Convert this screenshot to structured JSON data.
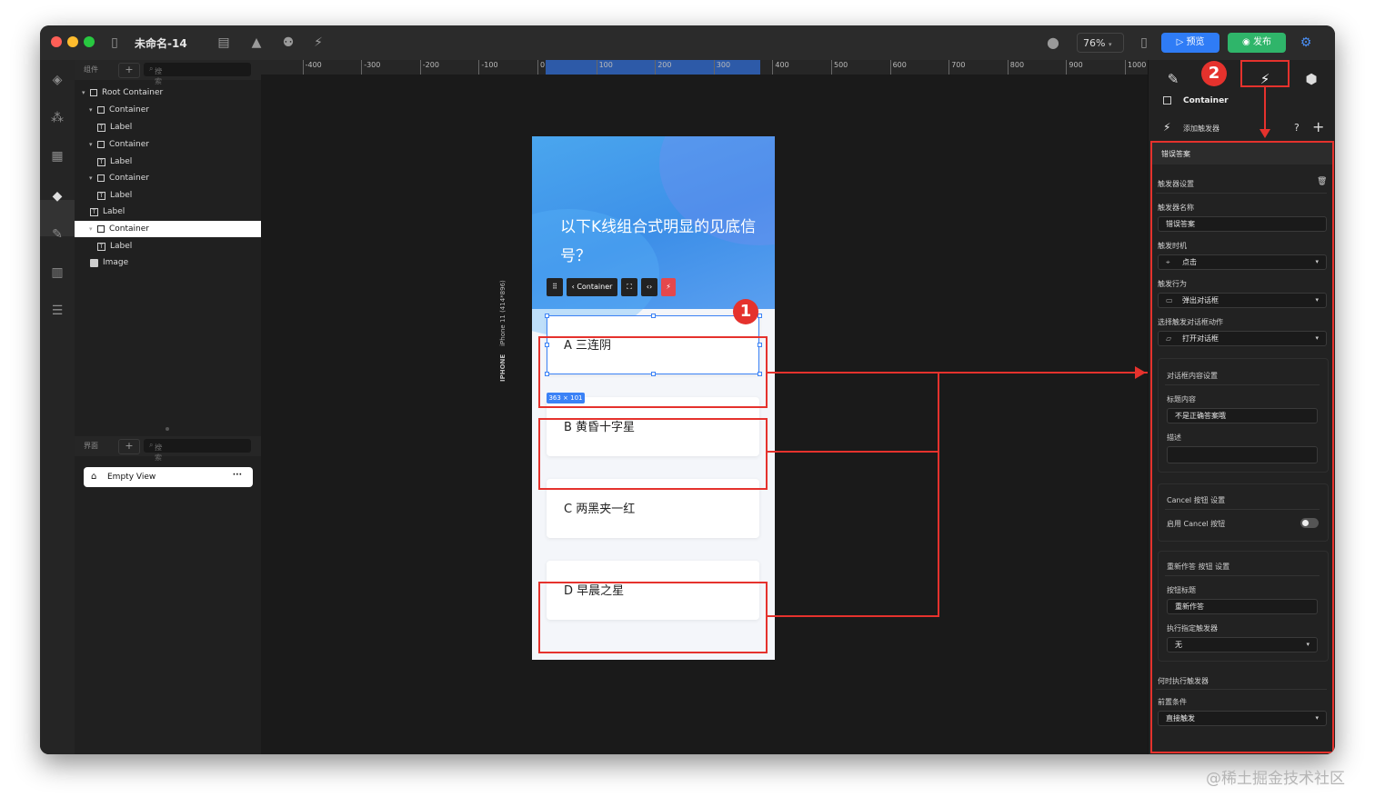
{
  "app": {
    "title": "未命名-14",
    "zoom": "76%",
    "preview_label": "预览",
    "publish_label": "发布"
  },
  "layers_panel": {
    "components_header": "组件",
    "search_placeholder": "搜索",
    "tree": [
      {
        "label": "Root Container",
        "kind": "container",
        "expanded": true
      },
      {
        "label": "Container",
        "kind": "container",
        "expanded": true
      },
      {
        "label": "Label",
        "kind": "label"
      },
      {
        "label": "Container",
        "kind": "container",
        "expanded": true
      },
      {
        "label": "Label",
        "kind": "label"
      },
      {
        "label": "Container",
        "kind": "container",
        "expanded": true
      },
      {
        "label": "Label",
        "kind": "label"
      },
      {
        "label": "Label",
        "kind": "label"
      },
      {
        "label": "Container",
        "kind": "container",
        "expanded": true,
        "selected": true
      },
      {
        "label": "Label",
        "kind": "label"
      },
      {
        "label": "Image",
        "kind": "image"
      }
    ],
    "pages_header": "界面",
    "pages_search_placeholder": "搜索",
    "pages": [
      {
        "label": "Empty View",
        "icon": "home-icon"
      }
    ]
  },
  "ruler": {
    "ticks": [
      "-400",
      "-300",
      "-200",
      "-100",
      "0",
      "100",
      "200",
      "300",
      "400",
      "500",
      "600",
      "700",
      "800",
      "900",
      "1000"
    ]
  },
  "phone": {
    "device_label": "IPHONE",
    "device_sublabel": "iPhone 11 (414*896)",
    "question": "以下K线组合式明显的见底信号？",
    "toolbar": {
      "container_label": "Container"
    },
    "selection_size": "363 × 101",
    "answers": [
      "A  三连阴",
      "B 黄昏十字星",
      "C 两黑夹一红",
      "D 早晨之星"
    ]
  },
  "callouts": [
    "1",
    "2"
  ],
  "right_panel": {
    "component_name": "Container",
    "add_trigger_label": "添加触发器",
    "trigger_title": "错误答案",
    "trigger_settings_label": "触发器设置",
    "trigger_name_label": "触发器名称",
    "trigger_name_value": "错误答案",
    "trigger_timing_label": "触发时机",
    "trigger_timing_value": "点击",
    "trigger_action_label": "触发行为",
    "trigger_action_value": "弹出对话框",
    "dialog_action_label": "选择触发对话框动作",
    "dialog_action_value": "打开对话框",
    "dialog_content_section": "对话框内容设置",
    "title_content_label": "标题内容",
    "title_content_value": "不是正确答案哦",
    "description_label": "描述",
    "description_value": "",
    "cancel_section": "Cancel 按钮 设置",
    "cancel_enable_label": "启用 Cancel 按钮",
    "cancel_enabled": false,
    "redo_section": "重新作答 按钮 设置",
    "button_title_label": "按钮标题",
    "button_title_value": "重新作答",
    "exec_trigger_label": "执行指定触发器",
    "exec_trigger_value": "无",
    "when_exec_label": "何时执行触发器",
    "precondition_label": "前置条件",
    "precondition_value": "直接触发"
  },
  "watermark": "@稀土掘金技术社区",
  "colors": {
    "accent_blue": "#2f7cf6",
    "publish_green": "#2fb56a",
    "annotation_red": "#e5322d"
  }
}
